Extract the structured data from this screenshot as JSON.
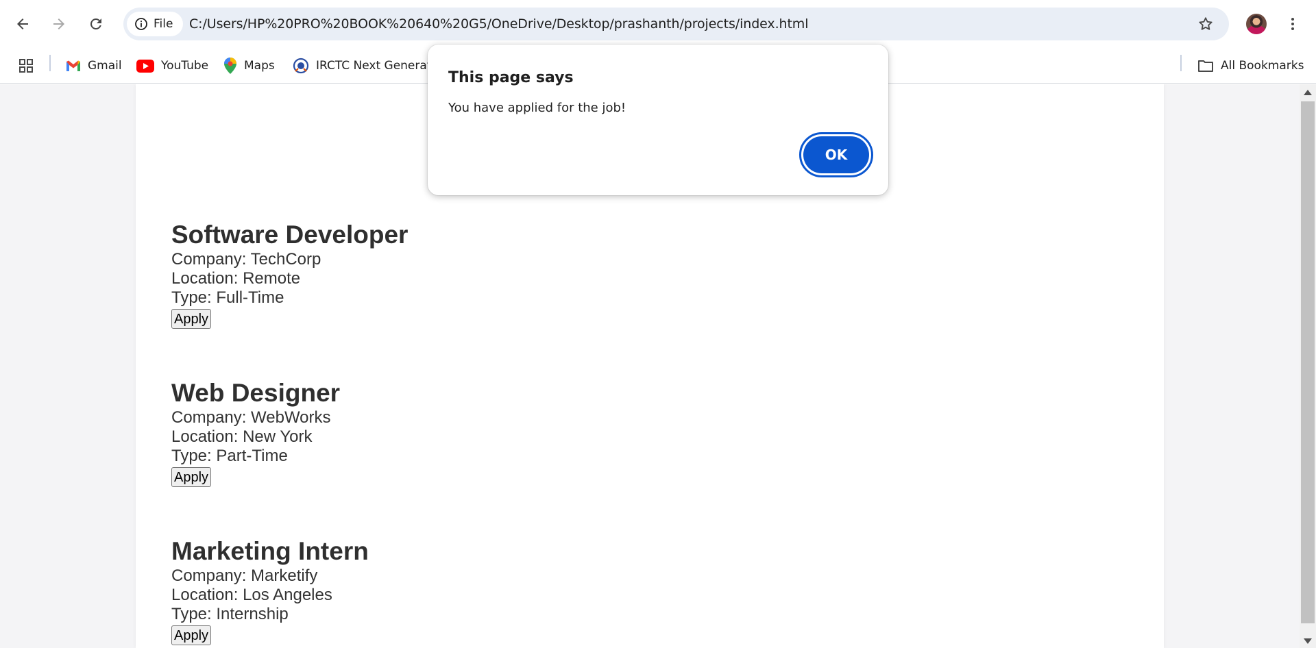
{
  "browser": {
    "url": "C:/Users/HP%20PRO%20BOOK%20640%20G5/OneDrive/Desktop/prashanth/projects/index.html",
    "site_chip_label": "File"
  },
  "bookmarks": {
    "items": [
      {
        "label": "Gmail",
        "icon": "gmail-icon"
      },
      {
        "label": "YouTube",
        "icon": "youtube-icon"
      },
      {
        "label": "Maps",
        "icon": "maps-icon"
      },
      {
        "label": "IRCTC Next Generati...",
        "icon": "irctc-icon"
      }
    ],
    "all_bookmarks_label": "All Bookmarks"
  },
  "jobs": [
    {
      "title": "Software Developer",
      "company": "Company: TechCorp",
      "location": "Location: Remote",
      "type": "Type: Full-Time",
      "apply_label": "Apply"
    },
    {
      "title": "Web Designer",
      "company": "Company: WebWorks",
      "location": "Location: New York",
      "type": "Type: Part-Time",
      "apply_label": "Apply"
    },
    {
      "title": "Marketing Intern",
      "company": "Company: Marketify",
      "location": "Location: Los Angeles",
      "type": "Type: Internship",
      "apply_label": "Apply"
    }
  ],
  "dialog": {
    "title": "This page says",
    "message": "You have applied for the job!",
    "ok_label": "OK"
  },
  "colors": {
    "accent": "#0b57d0",
    "omnibox_bg": "#e9eef6",
    "page_bg": "#f4f4f6"
  }
}
